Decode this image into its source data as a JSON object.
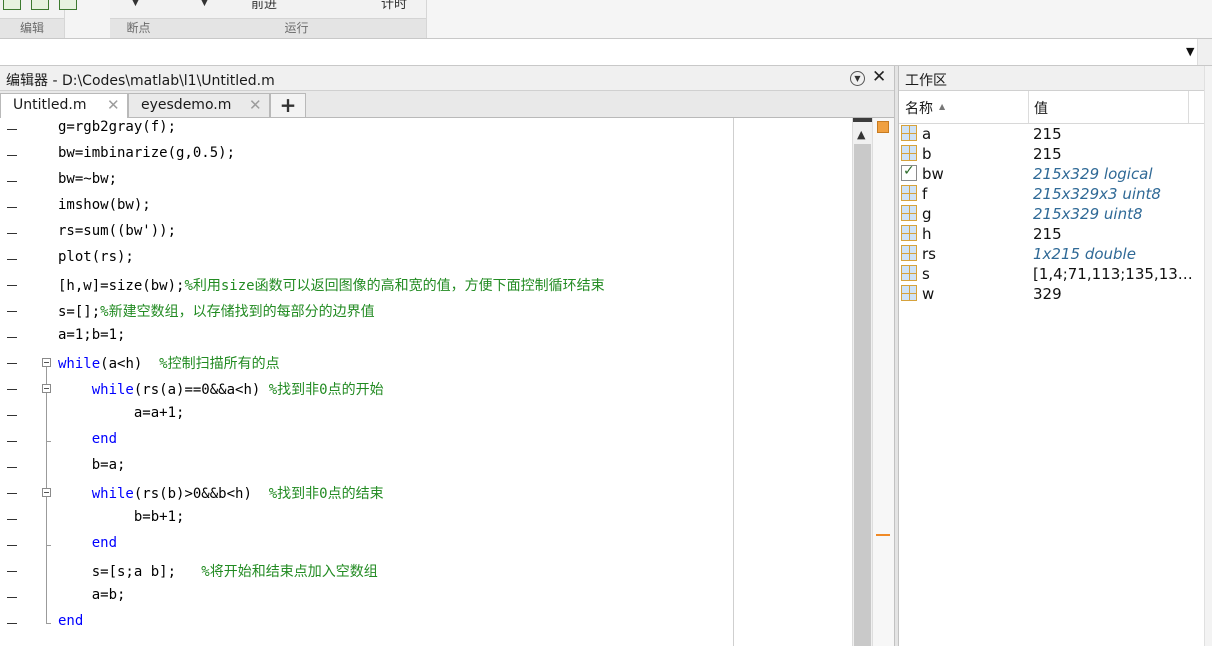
{
  "ribbon": {
    "groups": [
      {
        "label": "编辑"
      },
      {
        "label": "断点"
      },
      {
        "label": "运行"
      }
    ],
    "cut_labels": [
      "前进",
      "计时"
    ]
  },
  "editor": {
    "title": "编辑器 - D:\\Codes\\matlab\\l1\\Untitled.m",
    "tabs": [
      {
        "label": "Untitled.m",
        "active": true
      },
      {
        "label": "eyesdemo.m",
        "active": false
      }
    ],
    "lines": [
      [
        {
          "t": "g=rgb2gray(f);"
        }
      ],
      [
        {
          "t": "bw=imbinarize(g,0.5);"
        }
      ],
      [
        {
          "t": "bw=~bw;"
        }
      ],
      [
        {
          "t": "imshow(bw);"
        }
      ],
      [
        {
          "t": "rs=sum((bw'));"
        }
      ],
      [
        {
          "t": "plot(rs);"
        }
      ],
      [
        {
          "t": "[h,w]=size(bw);"
        },
        {
          "t": "%利用size函数可以返回图像的高和宽的值，方便下面控制循环结束",
          "c": "cm"
        }
      ],
      [
        {
          "t": "s=[];"
        },
        {
          "t": "%新建空数组，以存储找到的每部分的边界值",
          "c": "cm"
        }
      ],
      [
        {
          "t": "a=1;b=1;"
        }
      ],
      [
        {
          "t": "while",
          "c": "kw"
        },
        {
          "t": "(a<h)  "
        },
        {
          "t": "%控制扫描所有的点",
          "c": "cm"
        }
      ],
      [
        {
          "t": "    "
        },
        {
          "t": "while",
          "c": "kw"
        },
        {
          "t": "(rs(a)==0&&a<h) "
        },
        {
          "t": "%找到非0点的开始",
          "c": "cm"
        }
      ],
      [
        {
          "t": "         a=a+1;"
        }
      ],
      [
        {
          "t": "    "
        },
        {
          "t": "end",
          "c": "kw"
        }
      ],
      [
        {
          "t": "    b=a;"
        }
      ],
      [
        {
          "t": "    "
        },
        {
          "t": "while",
          "c": "kw"
        },
        {
          "t": "(rs(b)>0&&b<h)  "
        },
        {
          "t": "%找到非0点的结束",
          "c": "cm"
        }
      ],
      [
        {
          "t": "         b=b+1;"
        }
      ],
      [
        {
          "t": "    "
        },
        {
          "t": "end",
          "c": "kw"
        }
      ],
      [
        {
          "t": "    s=[s;a b];   "
        },
        {
          "t": "%将开始和结束点加入空数组",
          "c": "cm"
        }
      ],
      [
        {
          "t": "    a=b;"
        }
      ],
      [
        {
          "t": "end",
          "c": "kw"
        }
      ]
    ]
  },
  "workspace": {
    "title": "工作区",
    "col_name": "名称",
    "col_value": "值",
    "vars": [
      {
        "name": "a",
        "value": "215",
        "kind": "plain"
      },
      {
        "name": "b",
        "value": "215",
        "kind": "plain"
      },
      {
        "name": "bw",
        "value": "215x329 logical",
        "kind": "logical"
      },
      {
        "name": "f",
        "value": "215x329x3 uint8",
        "kind": "info"
      },
      {
        "name": "g",
        "value": "215x329 uint8",
        "kind": "info"
      },
      {
        "name": "h",
        "value": "215",
        "kind": "plain"
      },
      {
        "name": "rs",
        "value": "1x215 double",
        "kind": "info"
      },
      {
        "name": "s",
        "value": "[1,4;71,113;135,13…",
        "kind": "plain"
      },
      {
        "name": "w",
        "value": "329",
        "kind": "plain"
      }
    ]
  }
}
